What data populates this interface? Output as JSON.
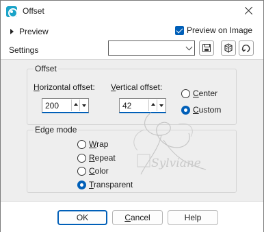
{
  "window": {
    "title": "Offset"
  },
  "preview": {
    "label": "Preview",
    "preview_on_image_label": "Preview on Image",
    "preview_on_image_checked": true
  },
  "settings": {
    "label": "Settings",
    "value": ""
  },
  "offset": {
    "group_title": "Offset",
    "horizontal": {
      "label_accel": "H",
      "label_rest": "orizontal offset:",
      "value": "200"
    },
    "vertical": {
      "label_accel": "V",
      "label_rest": "ertical offset:",
      "value": "42"
    },
    "center": {
      "label_accel": "C",
      "label_rest": "enter",
      "selected": false
    },
    "custom": {
      "label_accel": "C",
      "label_rest": "ustom",
      "selected": true
    }
  },
  "edge_mode": {
    "group_title": "Edge mode",
    "options": [
      {
        "accel": "W",
        "rest": "rap",
        "selected": false
      },
      {
        "accel": "R",
        "rest": "epeat",
        "selected": false
      },
      {
        "accel": "C",
        "rest": "olor",
        "selected": false
      },
      {
        "accel": "T",
        "rest": "ransparent",
        "selected": true
      }
    ]
  },
  "watermark_text": "Sylviane",
  "buttons": {
    "ok": "OK",
    "cancel_accel": "C",
    "cancel_rest": "ancel",
    "help": "Help"
  },
  "colors": {
    "accent": "#005fb8",
    "panel": "#eeeeee"
  },
  "icons": [
    "app-icon",
    "close-icon",
    "expand-caret-icon",
    "save-preset-icon",
    "cube-icon",
    "reset-icon"
  ]
}
